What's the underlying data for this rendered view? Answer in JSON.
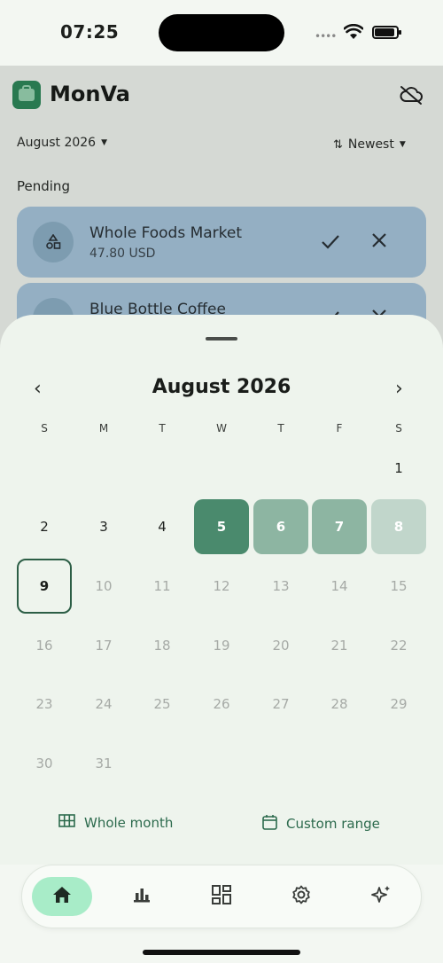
{
  "status_bar": {
    "time": "07:25"
  },
  "app": {
    "title": "MonVa"
  },
  "filters": {
    "month": "August 2026",
    "sort": "Newest"
  },
  "pending": {
    "heading": "Pending",
    "items": [
      {
        "name": "Whole Foods Market",
        "amount": "47.80 USD"
      },
      {
        "name": "Blue Bottle Coffee",
        "amount": ""
      }
    ]
  },
  "calendar": {
    "title": "August 2026",
    "weekdays": [
      "S",
      "M",
      "T",
      "W",
      "T",
      "F",
      "S"
    ],
    "first_weekday_index": 6,
    "days_in_month": 31,
    "today": 9,
    "selected_range": [
      5,
      8
    ]
  },
  "footer": {
    "whole_month_label": "Whole month",
    "custom_range_label": "Custom range"
  },
  "nav": {
    "items": [
      "home-icon",
      "chart-icon",
      "dashboard-icon",
      "settings-icon",
      "sparkles-icon"
    ],
    "active_index": 0
  },
  "colors": {
    "accent": "#4a8a6d",
    "nav_active": "#a8ecc8",
    "pending_card": "#a9c8de"
  }
}
